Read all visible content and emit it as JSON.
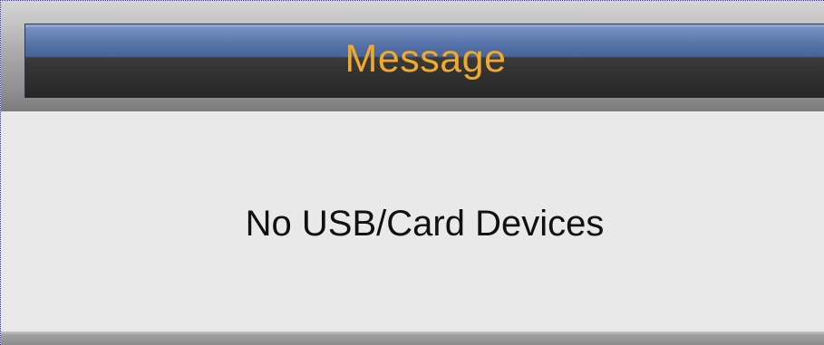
{
  "dialog": {
    "title": "Message",
    "message": "No USB/Card Devices"
  },
  "colors": {
    "title_text": "#f0a92a",
    "title_bar_top": "#6a85b9",
    "title_bar_bottom": "#2f2f2f",
    "body_background": "#e9e9e9",
    "message_text": "#111111"
  }
}
